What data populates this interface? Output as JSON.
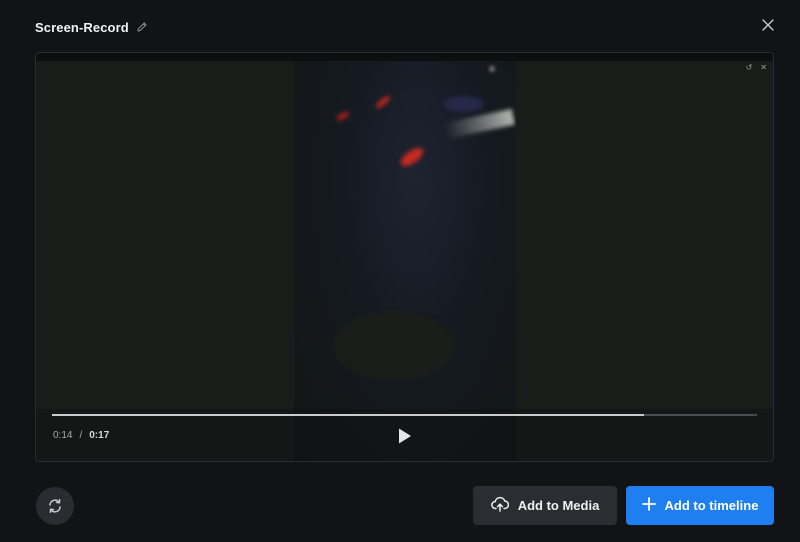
{
  "dialog": {
    "title": "Screen-Record",
    "icons": {
      "edit": "pencil-icon",
      "close": "close-icon"
    }
  },
  "player": {
    "current_time": "0:14",
    "separator": "/",
    "total_time": "0:17",
    "progress": 0.84,
    "icons": {
      "play": "play-icon"
    }
  },
  "actions": {
    "refresh_icon": "refresh-icon",
    "add_media_label": "Add to Media",
    "add_media_icon": "cloud-upload-icon",
    "add_timeline_label": "Add to timeline",
    "add_timeline_icon": "plus-icon"
  },
  "colors": {
    "background": "#121316",
    "accent": "#1f7ff0",
    "secondary_button": "#2b2d32"
  }
}
